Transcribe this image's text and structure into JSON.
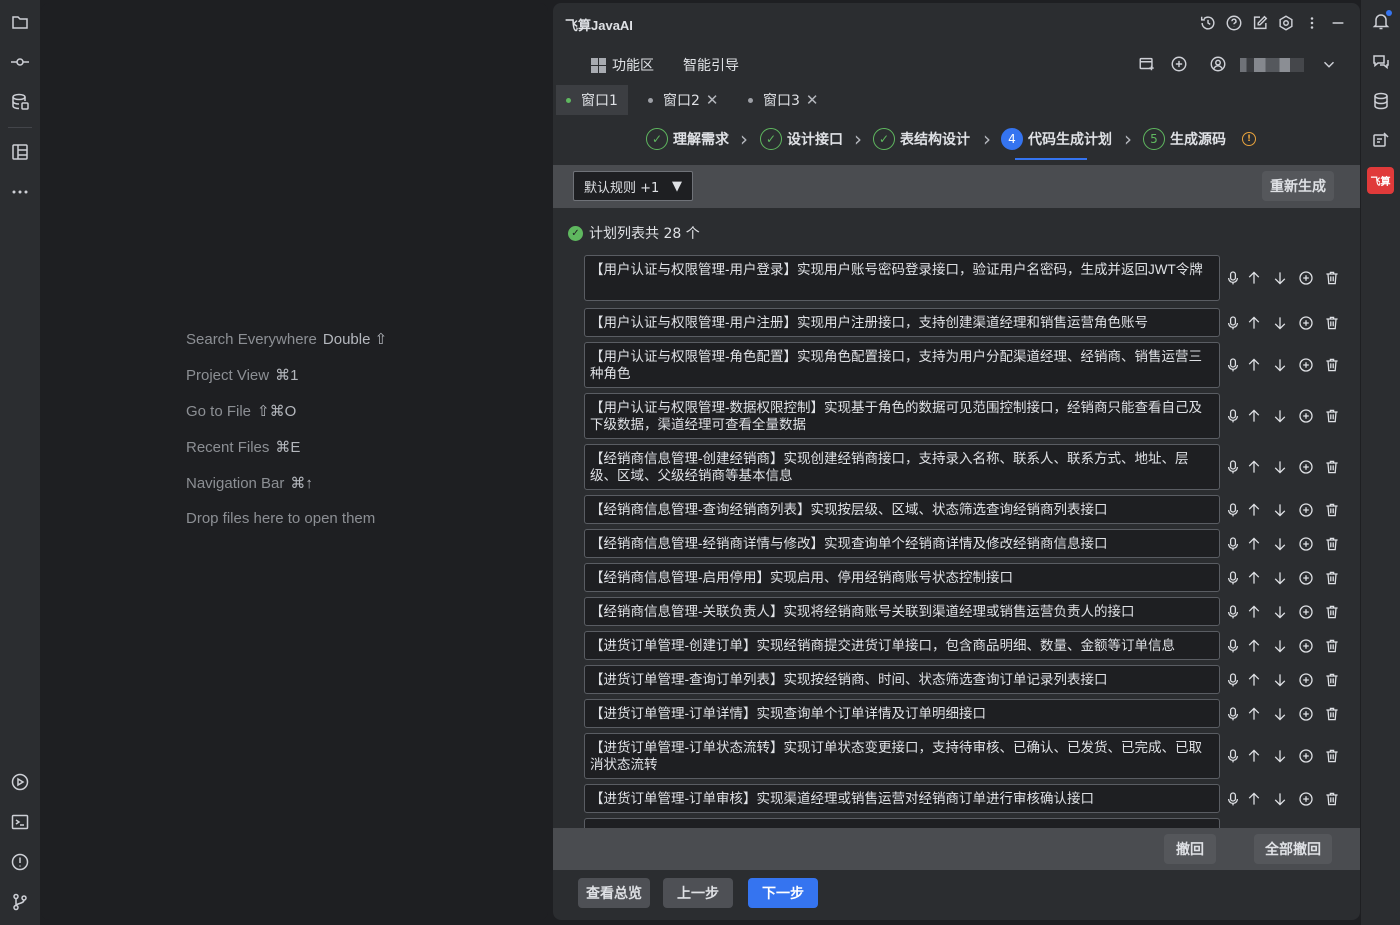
{
  "left_strip": {
    "top_icons": [
      "folder-icon",
      "commit-icon",
      "database-icon",
      "structure-icon",
      "more-icon"
    ],
    "bottom_icons": [
      "run-icon",
      "terminal-icon",
      "problems-icon",
      "git-branch-icon"
    ]
  },
  "editor_hints": [
    {
      "label": "Search Everywhere",
      "shortcut": "Double ⇧"
    },
    {
      "label": "Project View",
      "shortcut": "⌘1"
    },
    {
      "label": "Go to File",
      "shortcut": "⇧⌘O"
    },
    {
      "label": "Recent Files",
      "shortcut": "⌘E"
    },
    {
      "label": "Navigation Bar",
      "shortcut": "⌘↑"
    },
    {
      "label": "Drop files here to open them",
      "shortcut": ""
    }
  ],
  "panel": {
    "title": "飞算JavaAI",
    "header_icons": [
      "history-icon",
      "help-icon",
      "edit-icon",
      "settings-icon",
      "more-vertical-icon",
      "minimize-icon"
    ],
    "nav": {
      "feature_area": "功能区",
      "smart_guide": "智能引导"
    },
    "nav_icons": [
      "new-window-icon",
      "add-icon",
      "user-icon",
      "chevron-down-icon"
    ],
    "window_tabs": [
      {
        "label": "窗口1",
        "closable": false,
        "active": true
      },
      {
        "label": "窗口2",
        "closable": true,
        "active": false
      },
      {
        "label": "窗口3",
        "closable": true,
        "active": false
      }
    ],
    "steps": [
      {
        "num": "✓",
        "label": "理解需求",
        "state": "done"
      },
      {
        "num": "✓",
        "label": "设计接口",
        "state": "done"
      },
      {
        "num": "✓",
        "label": "表结构设计",
        "state": "done"
      },
      {
        "num": "4",
        "label": "代码生成计划",
        "state": "current"
      },
      {
        "num": "5",
        "label": "生成源码",
        "state": "todo"
      }
    ],
    "warn_glyph": "!",
    "toolbar": {
      "rule_select": "默认规则 +1",
      "regenerate": "重新生成"
    },
    "plan_count": "计划列表共 28 个",
    "plan_items": [
      "【用户认证与权限管理-用户登录】实现用户账号密码登录接口，验证用户名密码，生成并返回JWT令牌",
      "【用户认证与权限管理-用户注册】实现用户注册接口，支持创建渠道经理和销售运营角色账号",
      "【用户认证与权限管理-角色配置】实现角色配置接口，支持为用户分配渠道经理、经销商、销售运营三种角色",
      "【用户认证与权限管理-数据权限控制】实现基于角色的数据可见范围控制接口，经销商只能查看自己及下级数据，渠道经理可查看全量数据",
      "【经销商信息管理-创建经销商】实现创建经销商接口，支持录入名称、联系人、联系方式、地址、层级、区域、父级经销商等基本信息",
      "【经销商信息管理-查询经销商列表】实现按层级、区域、状态筛选查询经销商列表接口",
      "【经销商信息管理-经销商详情与修改】实现查询单个经销商详情及修改经销商信息接口",
      "【经销商信息管理-启用停用】实现启用、停用经销商账号状态控制接口",
      "【经销商信息管理-关联负责人】实现将经销商账号关联到渠道经理或销售运营负责人的接口",
      "【进货订单管理-创建订单】实现经销商提交进货订单接口，包含商品明细、数量、金额等订单信息",
      "【进货订单管理-查询订单列表】实现按经销商、时间、状态筛选查询订单记录列表接口",
      "【进货订单管理-订单详情】实现查询单个订单详情及订单明细接口",
      "【进货订单管理-订单状态流转】实现订单状态变更接口，支持待审核、已确认、已发货、已完成、已取消状态流转",
      "【进货订单管理-订单审核】实现渠道经理或销售运营对经销商订单进行审核确认接口"
    ],
    "row_actions": [
      "microphone-icon",
      "arrow-up-icon",
      "arrow-down-icon",
      "add-circle-icon",
      "trash-icon"
    ],
    "undo": "撤回",
    "undo_all": "全部撤回",
    "footer": {
      "overview": "查看总览",
      "prev": "上一步",
      "next": "下一步"
    }
  },
  "right_strip": {
    "icons": [
      "notifications-icon",
      "ai-chat-icon",
      "database-icon",
      "ai-assistant-icon"
    ],
    "brand_badge": "飞算"
  },
  "colors": {
    "accent": "#3574f0",
    "success": "#5fb85f",
    "warning": "#e8a33d",
    "brand": "#e03a3a"
  }
}
